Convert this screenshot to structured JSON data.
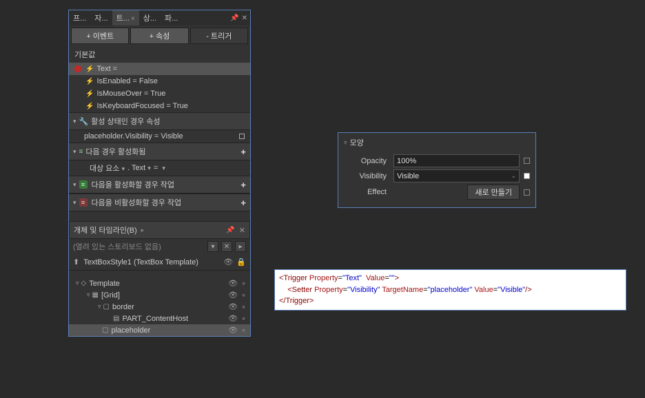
{
  "tabs": {
    "t1": "프...",
    "t2": "자...",
    "t3": "트...",
    "t4": "상...",
    "t5": "파..."
  },
  "buttons": {
    "event": "+ 이벤트",
    "prop": "+ 속성",
    "trigger": "- 트리거"
  },
  "section_default": "기본값",
  "triggers": {
    "text": "Text =",
    "isEnabled": "IsEnabled = False",
    "isMouseOver": "IsMouseOver = True",
    "isKeyboardFocused": "IsKeyboardFocused = True"
  },
  "sec_active": "활성 상태인 경우 속성",
  "prop_placeholder": "placeholder.Visibility = Visible",
  "sec_when": "다음 경우 활성화됨",
  "when_row": {
    "target": "대상 요소",
    "prop": ". Text",
    "val": "="
  },
  "sec_activate": "다음을 활성화할 경우 작업",
  "sec_deactivate": "다음을 비활성화할 경우 작업",
  "obj_title": "개체 및 타임라인(B)",
  "storyboard": "(열려 있는 스토리보드 없음)",
  "template_name": "TextBoxStyle1 (TextBox Template)",
  "tree": {
    "template": "Template",
    "grid": "[Grid]",
    "border": "border",
    "contentHost": "PART_ContentHost",
    "placeholder": "placeholder"
  },
  "props": {
    "title": "모양",
    "opacity_label": "Opacity",
    "opacity_val": "100%",
    "visibility_label": "Visibility",
    "visibility_val": "Visible",
    "effect_label": "Effect",
    "effect_btn": "새로 만들기"
  },
  "code": {
    "l1_open": "<Trigger ",
    "l1_p": "Property",
    "l1_pv": "\"Text\"",
    "l1_v": "  Value",
    "l1_vv": "\"\"",
    "l1_close": ">",
    "l2_open": "<Setter ",
    "l2_p": "Property",
    "l2_pv": "\"Visibility\"",
    "l2_t": "TargetName",
    "l2_tv": "\"placeholder\"",
    "l2_v": "Value",
    "l2_vv": "\"Visible\"",
    "l2_close": "/>",
    "l3": "</Trigger>"
  }
}
